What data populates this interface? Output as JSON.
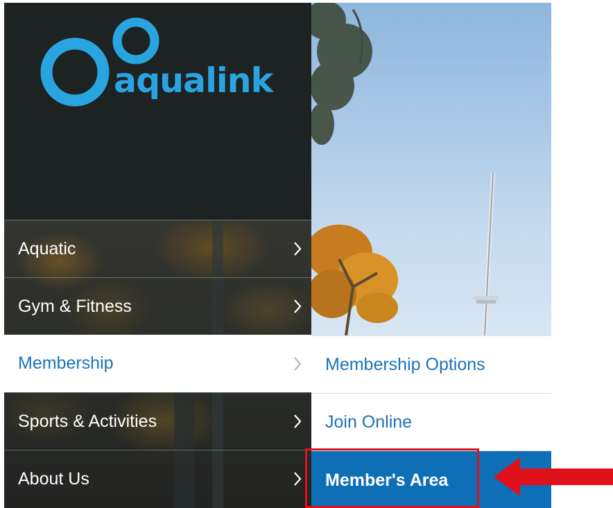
{
  "brand": {
    "name": "aqualink",
    "logo_color": "#2aa4e0",
    "logo_bg": "#1c2322"
  },
  "menu": {
    "items": [
      {
        "label": "Aquatic",
        "active": false
      },
      {
        "label": "Gym & Fitness",
        "active": false
      },
      {
        "label": "Membership",
        "active": true
      },
      {
        "label": "Sports & Activities",
        "active": false
      },
      {
        "label": "About Us",
        "active": false
      }
    ]
  },
  "submenu": {
    "items": [
      {
        "label": "Membership Options",
        "active": false
      },
      {
        "label": "Join Online",
        "active": false
      },
      {
        "label": "Member's Area",
        "active": true
      }
    ]
  },
  "annotation": {
    "highlight_color": "#e0111b",
    "target": "Member's Area"
  },
  "colors": {
    "accent": "#1a73b8",
    "active_bg": "#0e6fb7"
  }
}
